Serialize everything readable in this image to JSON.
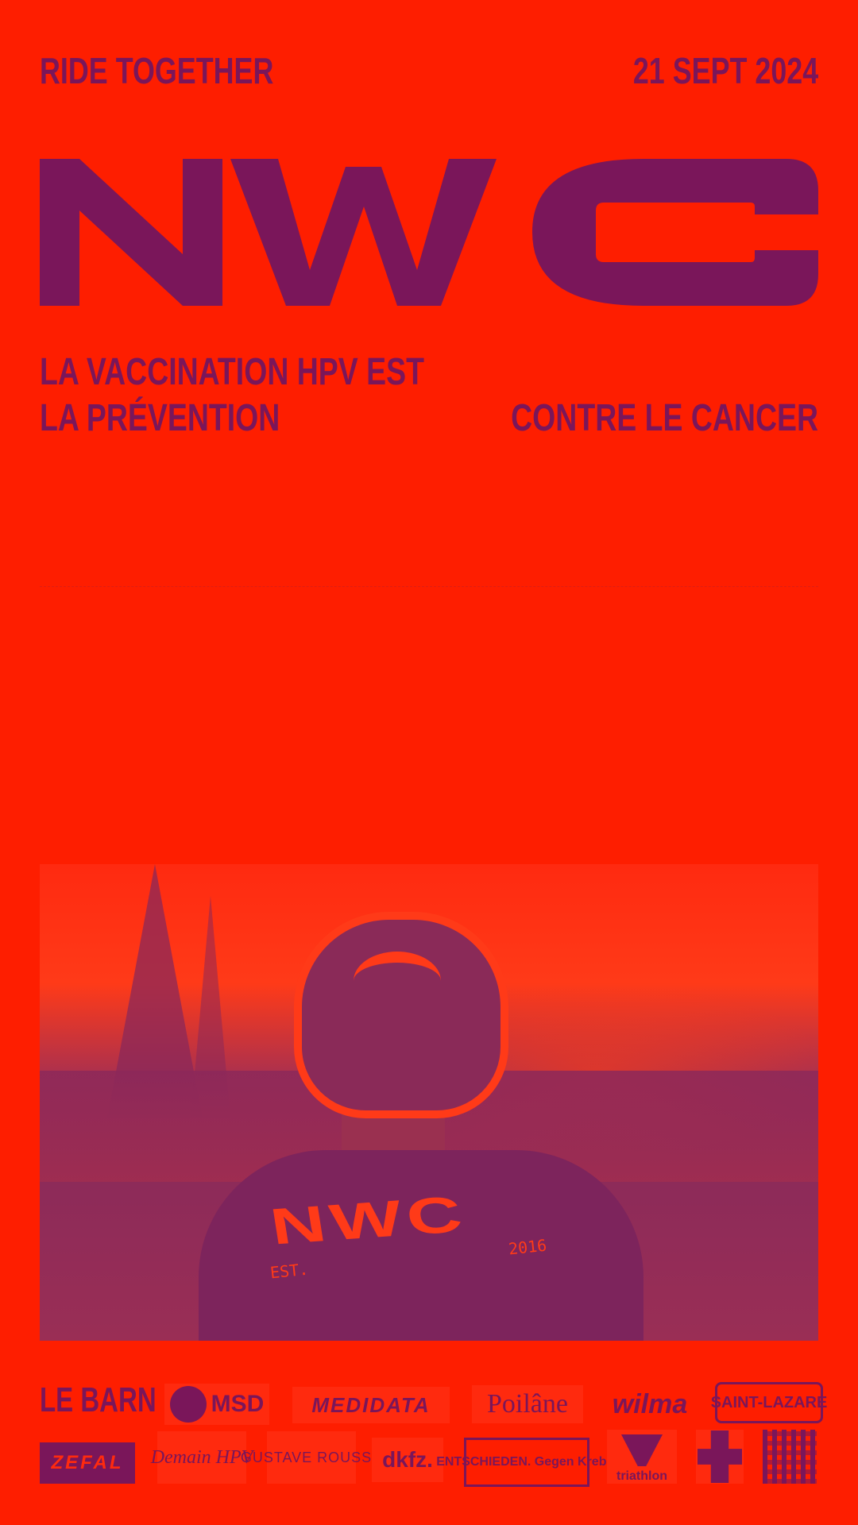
{
  "header": {
    "left": "RIDE TOGETHER",
    "right": "21 SEPT 2024"
  },
  "logo": {
    "text": "NWC"
  },
  "tagline": {
    "line1": "LA VACCINATION HPV EST",
    "line2": "LA PRÉVENTION",
    "right": "CONTRE LE CANCER"
  },
  "photo": {
    "jersey_text": "NWC",
    "jersey_est": "EST.",
    "jersey_year": "2016"
  },
  "sponsors": {
    "row1": [
      "LE BARN",
      "MSD",
      "MEDIDATA",
      "Poilâne",
      "wilma",
      "SAINT-LAZARE"
    ],
    "row2": [
      "ZEFAL",
      "Demain HPV",
      "GUSTAVE ROUSSY",
      "dkfz.",
      "ENTSCHIEDEN. Gegen Krebs.",
      "triathlon"
    ]
  },
  "colors": {
    "background": "#fe1e00",
    "foreground": "#7a165a"
  }
}
